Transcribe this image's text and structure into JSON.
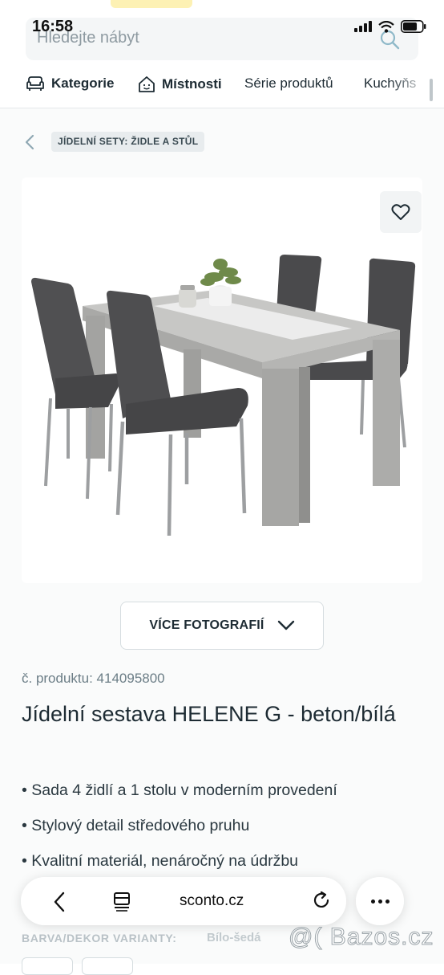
{
  "status": {
    "time": "16:58"
  },
  "search": {
    "placeholder": "Hledejte nábyt"
  },
  "nav": {
    "items": [
      {
        "label": "Kategorie",
        "icon": "sofa-icon"
      },
      {
        "label": "Místnosti",
        "icon": "house-icon"
      },
      {
        "label": "Série produktů"
      },
      {
        "label": "Kuchyňs"
      }
    ]
  },
  "breadcrumb": {
    "label": "JÍDELNÍ SETY: ŽIDLE A STŮL"
  },
  "gallery": {
    "more_photos_label": "VÍCE FOTOGRAFIÍ"
  },
  "product": {
    "code": "č. produktu: 414095800",
    "title": "Jídelní sestava HELENE G - beton/bílá",
    "bullets": [
      "Sada 4 židlí a 1 stolu v moderním provedení",
      "Stylový detail středového pruhu",
      "Kvalitní materiál, nenáročný na údržbu"
    ],
    "variant_label": "BARVA/DEKOR VARIANTY:",
    "variant_value": "Bílo-šedá"
  },
  "browser": {
    "url": "sconto.cz"
  },
  "watermark": "@( Bazos.cz",
  "colors": {
    "text": "#1d2b33",
    "muted": "#6b7d86",
    "breadcrumb_bg": "#e8ecee",
    "concrete": "#b9b9b7",
    "chair": "#4a4a4c"
  }
}
